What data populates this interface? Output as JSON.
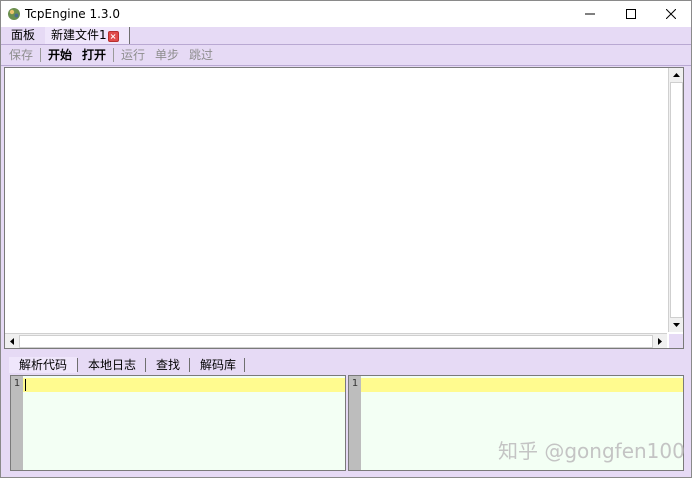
{
  "window": {
    "title": "TcpEngine 1.3.0"
  },
  "doc_tabs": [
    {
      "label": "面板"
    },
    {
      "label": "新建文件1"
    }
  ],
  "toolbar": {
    "save": "保存",
    "start": "开始",
    "open": "打开",
    "run": "运行",
    "step": "单步",
    "skip": "跳过"
  },
  "panel_tabs": [
    {
      "label": "解析代码"
    },
    {
      "label": "本地日志"
    },
    {
      "label": "查找"
    },
    {
      "label": "解码库"
    }
  ],
  "left_pane": {
    "line_number": "1"
  },
  "right_pane": {
    "line_number": "1"
  },
  "watermark": "知乎 @gongfen100",
  "colors": {
    "chrome_bg": "#e6daf5",
    "code_bg": "#f3fff4",
    "current_line": "#fffb8f",
    "tab_close": "#e04b4b"
  }
}
